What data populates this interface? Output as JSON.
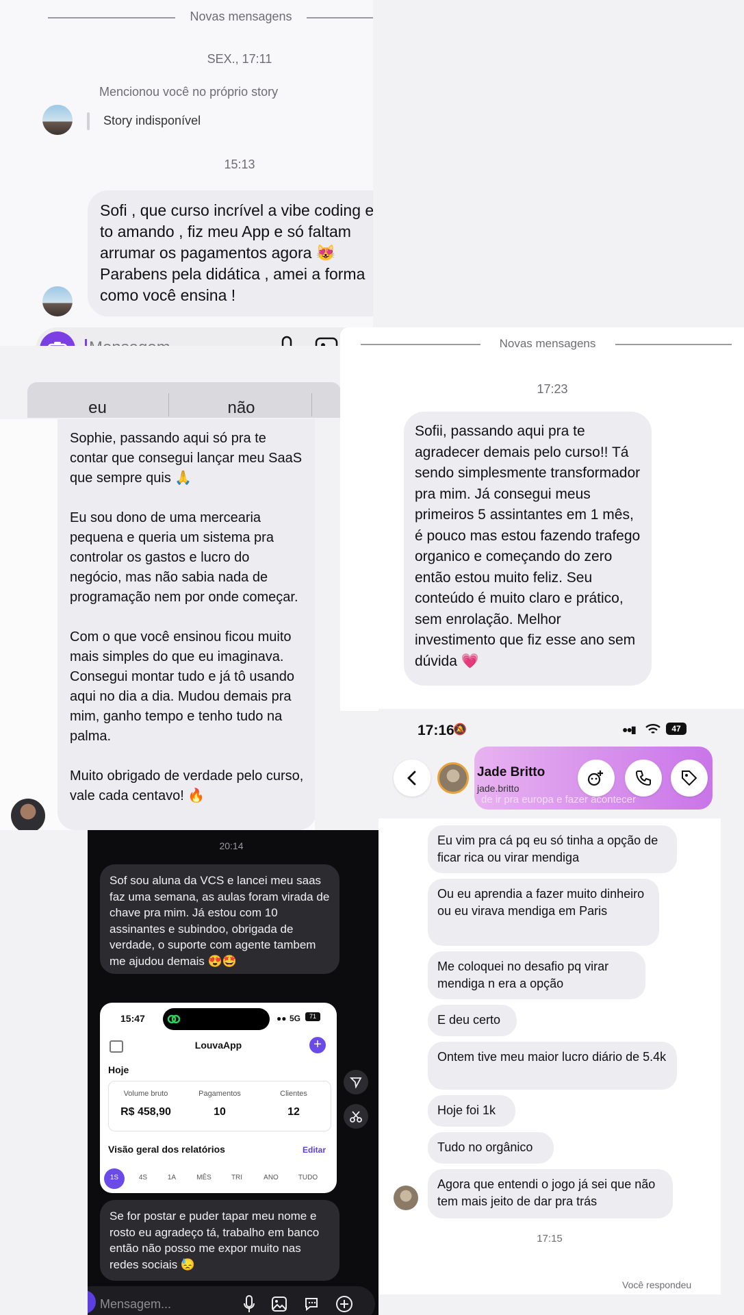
{
  "panel1": {
    "divider": "Novas mensagens",
    "date": "SEX., 17:11",
    "mention": "Mencionou você no próprio story",
    "story": "Story indisponível",
    "time": "15:13",
    "message": "Sofi , que curso incrível a vibe coding eu to amando , fiz meu App e só faltam arrumar os pagamentos agora 😻 Parabens pela didática , amei a forma como você ensina !",
    "input_placeholder": "Mensagem...",
    "suggestions": [
      "eu",
      "não"
    ]
  },
  "panel2": {
    "message_p1": "Sophie, passando aqui só pra te contar que consegui lançar meu SaaS que sempre quis 🙏",
    "message_p2": "Eu sou dono de uma mercearia pequena e queria um sistema pra controlar os gastos e lucro do negócio, mas não sabia nada de programação nem por onde começar.",
    "message_p3": "Com o que você ensinou ficou muito mais simples do que eu imaginava. Consegui montar tudo e já tô usando aqui no dia a dia. Mudou demais pra mim, ganho tempo e tenho tudo na palma.",
    "message_p4": "Muito obrigado de verdade pelo curso, vale cada centavo! 🔥"
  },
  "panel3": {
    "divider": "Novas mensagens",
    "time": "17:23",
    "message": "Sofii, passando aqui pra te agradecer demais pelo curso!! Tá sendo simplesmente transformador pra mim. Já consegui meus primeiros 5 assintantes em 1 mês, é pouco mas estou fazendo trafego organico e começando do zero então estou muito feliz. Seu conteúdo é muito claro e prático, sem enrolação. Melhor investimento que fiz esse ano sem dúvida 💗"
  },
  "panel4": {
    "time": "20:14",
    "message1": "Sof sou aluna da VCS e lancei meu saas faz uma semana, as aulas foram virada de chave pra mim. Já estou com 10 assinantes e subindoo, obrigada de verdade, o suporte com agente tambem me ajudou demais 😍🤩",
    "phone": {
      "time": "15:47",
      "signal": "5G",
      "battery": "71",
      "app_title": "LouvaApp",
      "today": "Hoje",
      "stats": [
        {
          "label": "Volume bruto",
          "value": "R$ 458,90"
        },
        {
          "label": "Pagamentos",
          "value": "10"
        },
        {
          "label": "Clientes",
          "value": "12"
        }
      ],
      "reports_title": "Visão geral dos relatórios",
      "edit": "Editar",
      "ranges": [
        "1S",
        "4S",
        "1A",
        "MÊS",
        "TRI",
        "ANO",
        "TUDO"
      ]
    },
    "message2": "Se for postar e puder tapar meu nome e rosto eu agradeço tá, trabalho em banco então não posso me expor muito nas redes sociais 😓",
    "input_placeholder": "Mensagem..."
  },
  "panel5": {
    "status_time": "17:16",
    "battery": "47",
    "contact_name": "Jade Britto",
    "contact_handle": "jade.britto",
    "reply_snippet": "de ir pra europa e fazer acontecer",
    "messages": [
      "Eu vim pra cá pq eu só tinha a opção de ficar rica ou virar mendiga",
      "Ou eu aprendia a fazer muito dinheiro ou eu virava mendiga em Paris",
      "Me coloquei no desafio pq virar mendiga n era a opção",
      "E deu certo",
      "Ontem tive meu maior lucro diário de 5.4k",
      "Hoje foi 1k",
      "Tudo no orgânico",
      "Agora que entendi o jogo já sei que não tem mais jeito de dar pra trás"
    ],
    "time": "17:15",
    "replied": "Você respondeu"
  },
  "colors": {
    "accent_purple": "#7b3fe4",
    "bubble_gray": "#ececf1",
    "dark_bubble": "#2b2b30"
  }
}
